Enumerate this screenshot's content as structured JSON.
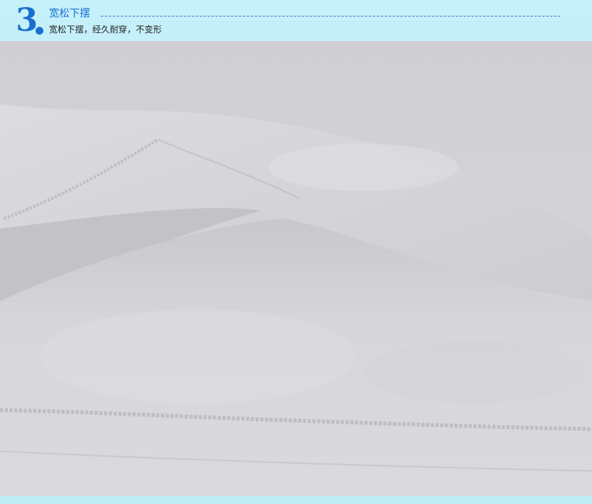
{
  "header": {
    "step_number": "3",
    "title": "宽松下摆",
    "subtitle": "宽松下摆，经久耐穿，不变形"
  },
  "colors": {
    "background": "#b9ecf7",
    "accent": "#1a6fd0",
    "fabric": "#d6d6da"
  }
}
